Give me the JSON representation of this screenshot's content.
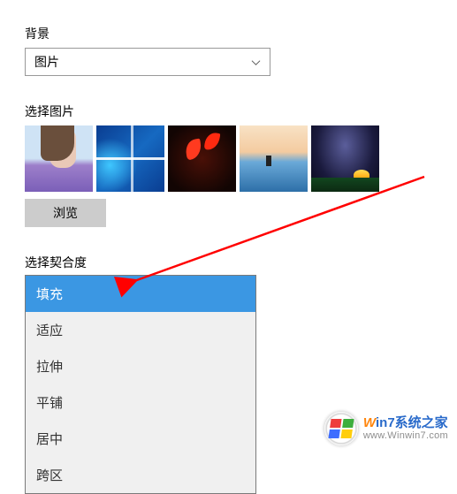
{
  "background": {
    "label": "背景",
    "dropdown_value": "图片"
  },
  "choose_picture": {
    "label": "选择图片",
    "thumbnails": [
      {
        "name": "girl-lavender"
      },
      {
        "name": "windows-default"
      },
      {
        "name": "tulips-dark"
      },
      {
        "name": "beach-sunset"
      },
      {
        "name": "night-camp"
      }
    ],
    "browse_label": "浏览"
  },
  "fit": {
    "label": "选择契合度",
    "options": [
      "填充",
      "适应",
      "拉伸",
      "平铺",
      "居中",
      "跨区"
    ],
    "selected_index": 0
  },
  "watermark": {
    "line1_prefix": "W",
    "line1_mid": "in7",
    "line1_suffix": "系统之家",
    "line2": "www.Winwin7.com"
  }
}
